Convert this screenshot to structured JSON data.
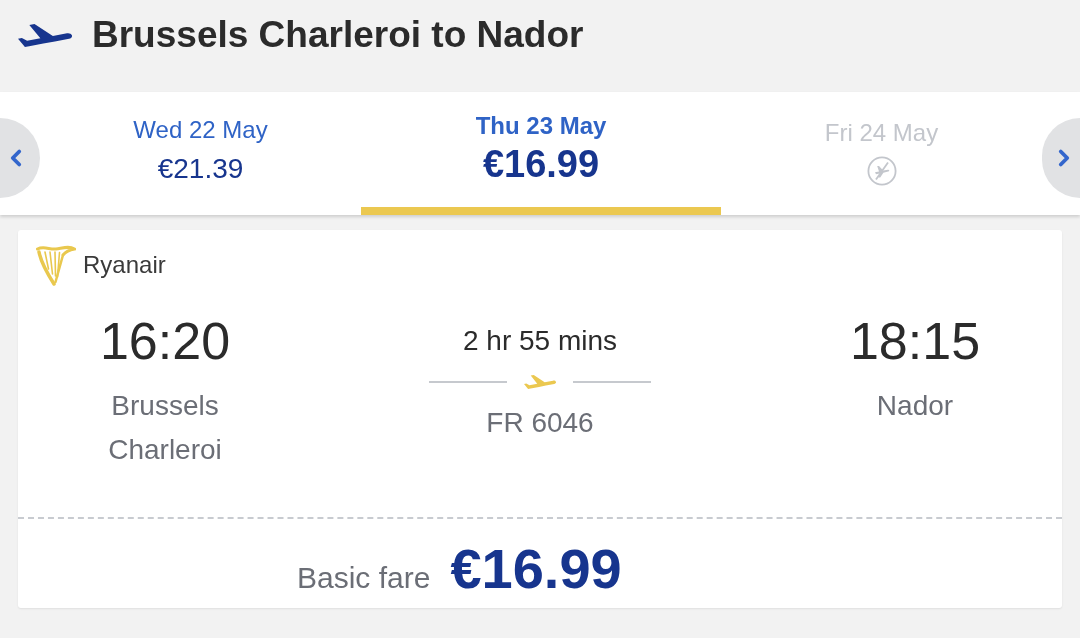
{
  "header": {
    "title": "Brussels Charleroi to Nador"
  },
  "date_tabs": [
    {
      "date": "Wed 22 May",
      "price": "€21.39",
      "selected": false,
      "available": true
    },
    {
      "date": "Thu 23 May",
      "price": "€16.99",
      "selected": true,
      "available": true
    },
    {
      "date": "Fri 24 May",
      "selected": false,
      "available": false
    }
  ],
  "flight": {
    "airline": "Ryanair",
    "departure": {
      "time": "16:20",
      "airport": "Brussels Charleroi"
    },
    "duration": "2 hr 55 mins",
    "flight_number": "FR 6046",
    "arrival": {
      "time": "18:15",
      "airport": "Nador"
    },
    "fare_label": "Basic fare",
    "fare_price": "€16.99"
  }
}
